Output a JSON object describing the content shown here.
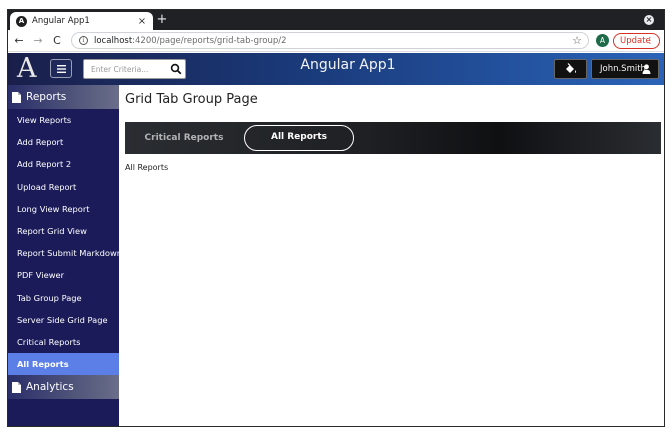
{
  "browser": {
    "tab_title": "Angular App1",
    "tab_close": "×",
    "new_tab": "+",
    "url_host": "localhost",
    "url_path": ":4200/page/reports/grid-tab-group/2",
    "profile_initial": "A",
    "update_label": "Update",
    "update_menu": "⋮"
  },
  "header": {
    "logo": "A",
    "app_title": "Angular App1",
    "search_placeholder": "Enter Criteria...",
    "user_name": "John.Smith"
  },
  "sidebar": {
    "reports_label": "Reports",
    "items": [
      {
        "label": "View Reports"
      },
      {
        "label": "Add Report"
      },
      {
        "label": "Add Report 2"
      },
      {
        "label": "Upload Report"
      },
      {
        "label": "Long View Report"
      },
      {
        "label": "Report Grid View"
      },
      {
        "label": "Report Submit Markdown"
      },
      {
        "label": "PDF Viewer"
      },
      {
        "label": "Tab Group Page"
      },
      {
        "label": "Server Side Grid Page"
      },
      {
        "label": "Critical Reports"
      },
      {
        "label": "All Reports"
      }
    ],
    "active_index": 11,
    "analytics_label": "Analytics"
  },
  "main": {
    "page_title": "Grid Tab Group Page",
    "tabs": [
      {
        "label": "Critical Reports"
      },
      {
        "label": "All Reports"
      }
    ],
    "selected_tab": 1,
    "content_text": "All Reports"
  },
  "colors": {
    "sidebar_bg": "#1b1b5a",
    "active_item": "#5b7fe6",
    "update_red": "#d93025"
  }
}
